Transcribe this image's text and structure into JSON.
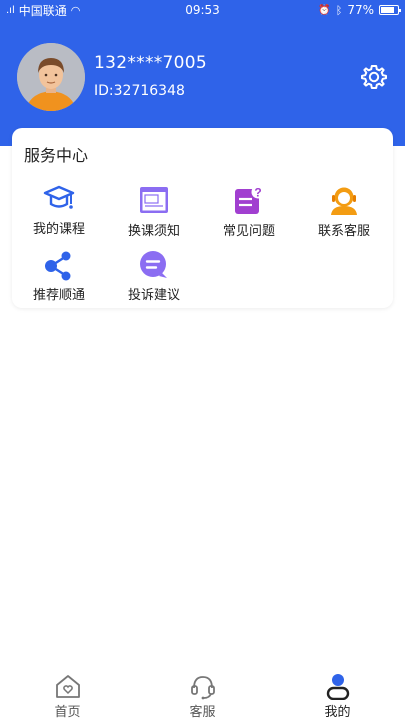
{
  "status_bar": {
    "carrier": "中国联通",
    "time": "09:53",
    "battery": "77%"
  },
  "profile": {
    "phone": "132****7005",
    "user_id": "ID:32716348"
  },
  "service_center": {
    "title": "服务中心",
    "items": [
      {
        "label": "我的课程",
        "icon": "graduation-cap-icon"
      },
      {
        "label": "换课须知",
        "icon": "document-window-icon"
      },
      {
        "label": "常见问题",
        "icon": "faq-icon"
      },
      {
        "label": "联系客服",
        "icon": "customer-service-icon"
      },
      {
        "label": "推荐顺通",
        "icon": "share-icon"
      },
      {
        "label": "投诉建议",
        "icon": "chat-bubble-icon"
      }
    ]
  },
  "tabbar": {
    "tabs": [
      {
        "label": "首页",
        "icon": "home-icon"
      },
      {
        "label": "客服",
        "icon": "headset-icon"
      },
      {
        "label": "我的",
        "icon": "person-icon"
      }
    ],
    "active": "我的"
  },
  "colors": {
    "primary": "#2f63e9",
    "purple": "#8b6df2",
    "orange": "#f39c12"
  }
}
